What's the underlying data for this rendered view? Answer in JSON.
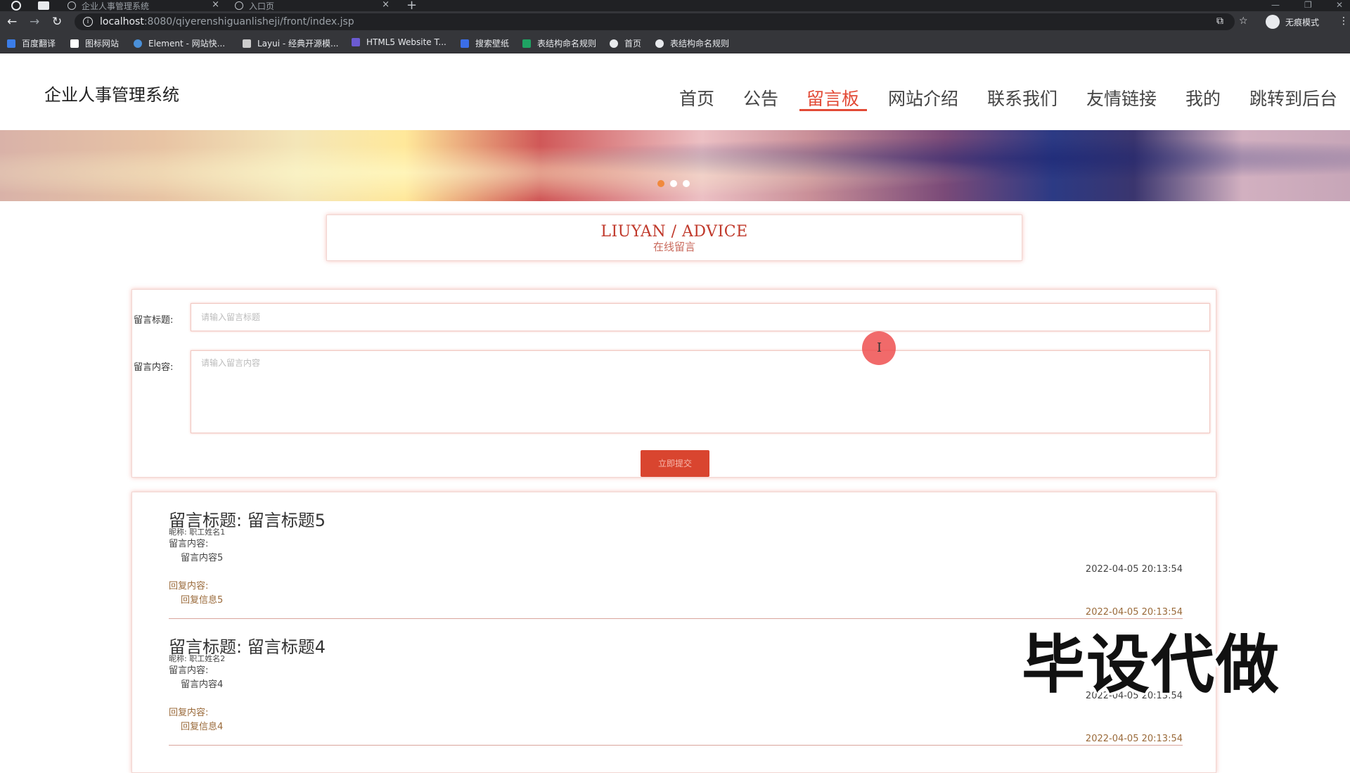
{
  "browser": {
    "tabs": [
      {
        "title": "企业人事管理系统",
        "close": "×"
      },
      {
        "title": "入口页",
        "close": "×"
      }
    ],
    "new_tab": "+",
    "window_controls": {
      "minimize": "—",
      "restore": "❐",
      "close": "✕"
    },
    "nav": {
      "back": "←",
      "forward": "→",
      "reload": "↻"
    },
    "address": {
      "host": "localhost",
      "path": ":8080/qiyerenshiguanlisheji/front/index.jsp"
    },
    "incognito_label": "无痕模式",
    "bookmarks": [
      {
        "label": "百度翻译",
        "color": "#3b7de8"
      },
      {
        "label": "图标网站",
        "color": "#ffffff"
      },
      {
        "label": "Element - 网站快...",
        "color": "#4a90d9"
      },
      {
        "label": "Layui - 经典开源模...",
        "color": "#cccccc"
      },
      {
        "label": "HTML5 Website T...",
        "color": "#6b5bd2"
      },
      {
        "label": "搜索壁纸",
        "color": "#3b6ee8"
      },
      {
        "label": "表结构命名规则",
        "color": "#1fa463"
      },
      {
        "label": "首页",
        "color": "#e8eaed"
      },
      {
        "label": "表结构命名规则",
        "color": "#e8eaed"
      }
    ]
  },
  "site": {
    "logo": "企业人事管理系统",
    "nav": [
      "首页",
      "公告",
      "留言板",
      "网站介绍",
      "联系我们",
      "友情链接",
      "我的",
      "跳转到后台"
    ],
    "active_nav": "留言板",
    "accent_color": "#e24a36"
  },
  "carousel": {
    "slide_count": 3,
    "active_index": 0
  },
  "page_title": {
    "en": "LIUYAN / ADVICE",
    "cn": "在线留言"
  },
  "form": {
    "title_label": "留言标题:",
    "title_placeholder": "请输入留言标题",
    "content_label": "留言内容:",
    "content_placeholder": "请输入留言内容",
    "submit_label": "立即提交"
  },
  "messages": [
    {
      "title": "留言标题:  留言标题5",
      "nickname": "昵称:  职工姓名1",
      "content_label": "留言内容:",
      "content": "留言内容5",
      "time": "2022-04-05 20:13:54",
      "reply_label": "回复内容:",
      "reply": "回复信息5",
      "reply_time": "2022-04-05 20:13:54"
    },
    {
      "title": "留言标题:  留言标题4",
      "nickname": "昵称:  职工姓名2",
      "content_label": "留言内容:",
      "content": "留言内容4",
      "time": "2022-04-05 20:13:54",
      "reply_label": "回复内容:",
      "reply": "回复信息4",
      "reply_time": "2022-04-05 20:13:54"
    }
  ],
  "watermark": "毕设代做"
}
